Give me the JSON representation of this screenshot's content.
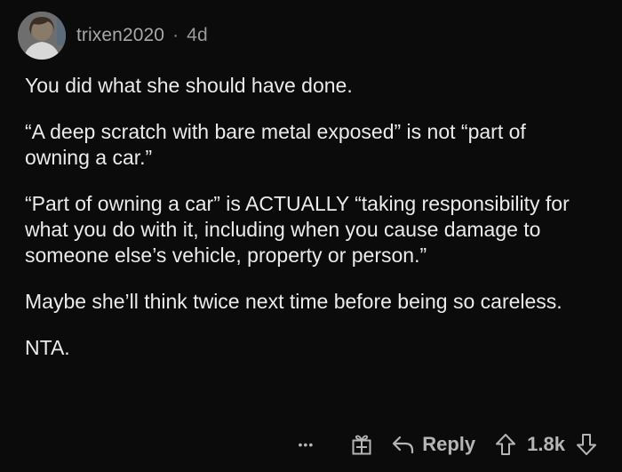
{
  "comment": {
    "author": "trixen2020",
    "separator": "·",
    "age": "4d",
    "paragraphs": [
      "You did what she should have done.",
      "“A deep scratch with bare metal exposed” is not “part of owning a car.”",
      "“Part of owning a car” is ACTUALLY “taking responsibility for what you do with it, including when you cause damage to someone else’s vehicle, property or person.”",
      "Maybe she’ll think twice next time before being so careless.",
      "NTA."
    ]
  },
  "actions": {
    "more_label": "•••",
    "reply_label": "Reply",
    "score": "1.8k"
  },
  "icons": {
    "more": "more-dots-icon",
    "award": "gift-award-icon",
    "reply": "reply-arrow-icon",
    "upvote": "upvote-arrow-icon",
    "downvote": "downvote-arrow-icon"
  },
  "colors": {
    "background": "#0b0b0b",
    "text": "#ebebeb",
    "muted": "#9a9a9a",
    "icon": "#b5b5b5"
  }
}
